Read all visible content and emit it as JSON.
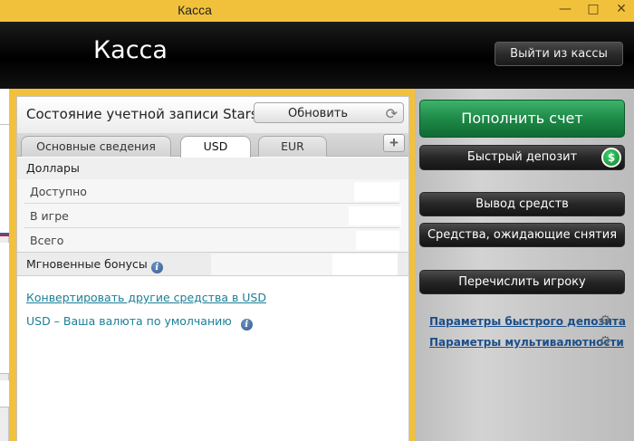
{
  "window": {
    "title": "Касса",
    "minimize_icon": "minimize-icon",
    "maximize_icon": "maximize-icon",
    "close_icon": "close-icon"
  },
  "header": {
    "title": "Касса",
    "exit_label": "Выйти из кассы"
  },
  "account": {
    "title": "Состояние учетной записи Stars",
    "refresh_label": "Обновить",
    "tabs": [
      {
        "label": "Основные сведения",
        "active": false
      },
      {
        "label": "USD",
        "active": true
      },
      {
        "label": "EUR",
        "active": false
      }
    ],
    "add_tab_label": "+",
    "section_title": "Доллары",
    "rows": [
      {
        "label": "Доступно"
      },
      {
        "label": "В игре"
      },
      {
        "label": "Всего"
      }
    ],
    "bonus_label": "Мгновенные бонусы",
    "convert_link": "Конвертировать другие средства в USD",
    "default_currency_text": "USD – Ваша валюта по умолчанию"
  },
  "actions": {
    "deposit_label": "Пополнить счет",
    "quick_deposit_label": "Быстрый депозит",
    "withdraw_label": "Вывод средств",
    "pending_label": "Средства, ожидающие снятия",
    "transfer_label": "Перечислить игроку",
    "quick_deposit_settings_link": "Параметры быстрого депозита",
    "multicurrency_settings_link": "Параметры мультивалютности"
  },
  "colors": {
    "titlebar": "#f2c13c",
    "deposit_green": "#1e8a47",
    "link": "#1a7f98"
  }
}
